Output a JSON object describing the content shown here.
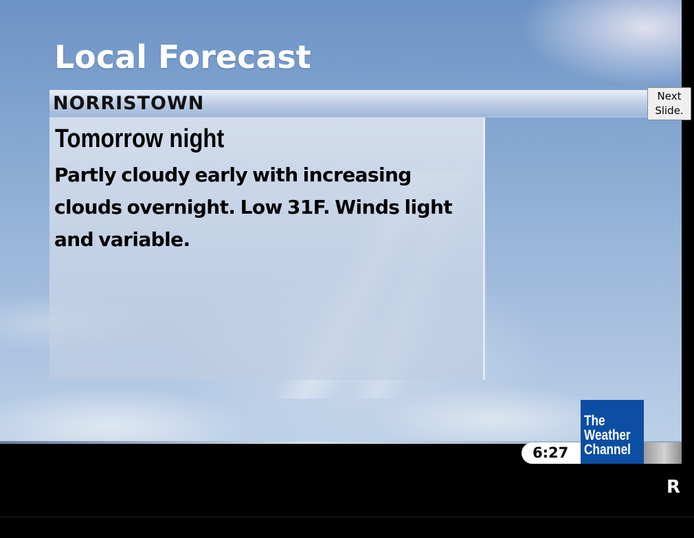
{
  "header": {
    "title": "Local Forecast"
  },
  "location": {
    "name": "NORRISTOWN"
  },
  "forecast": {
    "period": "Tomorrow night",
    "text": "Partly cloudy early with increasing clouds overnight. Low 31F. Winds light and variable."
  },
  "controls": {
    "next_slide_label": "Next\nSlide."
  },
  "footer": {
    "time": "6:27",
    "logo_text": "The\nWeather\nChannel",
    "ticker_text": "R"
  },
  "colors": {
    "logo_blue": "#0b4ea3",
    "sky_top": "#6c93c6",
    "sky_bottom": "#bcd0e8",
    "bar_background": "#000000"
  },
  "icons": {
    "logo": "the-weather-channel-logo"
  }
}
